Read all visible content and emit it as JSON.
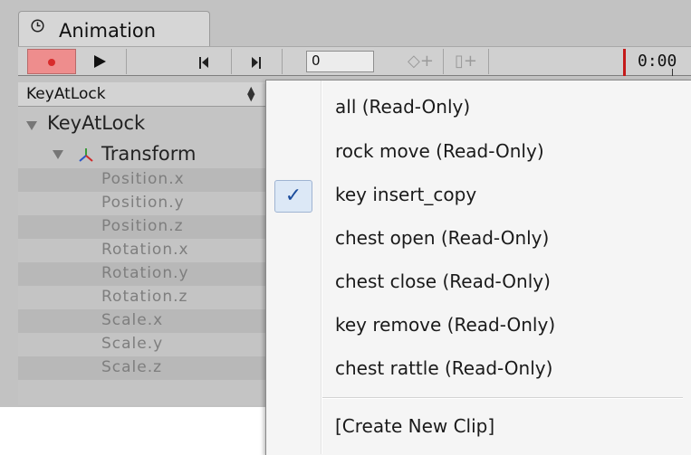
{
  "window": {
    "tab_title": "Animation"
  },
  "toolbar": {
    "frame_value": "0",
    "time_label": "0:00",
    "add_keyframe_glyph": "◇+",
    "add_event_glyph": "▯+"
  },
  "clip_selector": {
    "selected": "KeyAtLock",
    "arrows": "⬍"
  },
  "hierarchy": {
    "root": "KeyAtLock",
    "transform": "Transform",
    "properties": [
      "Position.x",
      "Position.y",
      "Position.z",
      "Rotation.x",
      "Rotation.y",
      "Rotation.z",
      "Scale.x",
      "Scale.y",
      "Scale.z"
    ]
  },
  "menu": {
    "items": [
      {
        "label": "all (Read-Only)",
        "checked": false
      },
      {
        "label": "rock move (Read-Only)",
        "checked": false
      },
      {
        "label": "key insert_copy",
        "checked": true
      },
      {
        "label": "chest open (Read-Only)",
        "checked": false
      },
      {
        "label": "chest close (Read-Only)",
        "checked": false
      },
      {
        "label": "key remove (Read-Only)",
        "checked": false
      },
      {
        "label": "chest rattle (Read-Only)",
        "checked": false
      }
    ],
    "create_new": "[Create New Clip]",
    "check_glyph": "✓"
  },
  "colors": {
    "record_active": "#ee8d8d",
    "time_marker": "#c41a1a",
    "checked_highlight": "#dce8f6",
    "check_mark": "#1b4c9c"
  },
  "icons": {
    "tab": "clock-icon",
    "record": "record-icon",
    "play": "play-icon",
    "prev": "previous-keyframe-icon",
    "next": "next-keyframe-icon",
    "add_key": "add-keyframe-icon",
    "add_event": "add-event-icon",
    "transform": "transform-axis-icon",
    "fold": "fold-triangle-icon",
    "check": "checkmark-icon"
  }
}
